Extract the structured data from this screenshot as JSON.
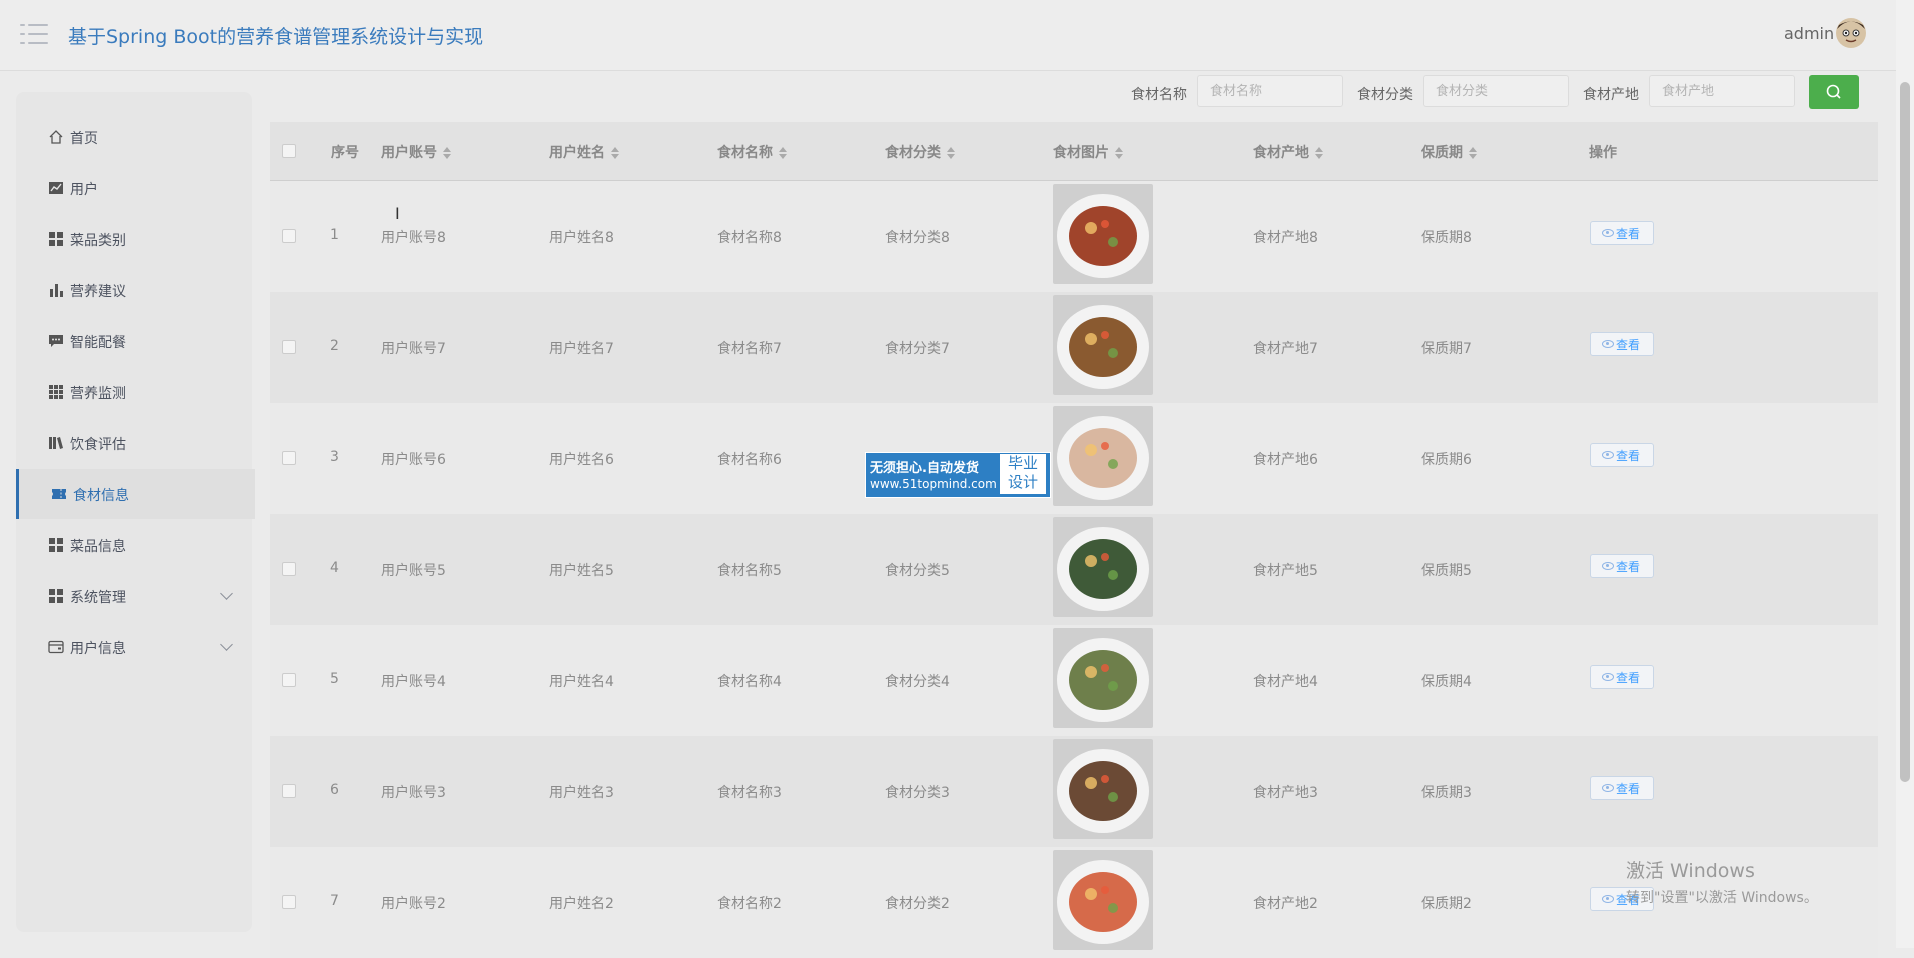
{
  "header": {
    "title": "基于Spring Boot的营养食谱管理系统设计与实现",
    "username": "admin"
  },
  "sidebar": {
    "items": [
      {
        "label": "首页",
        "icon": "home-icon",
        "active": false,
        "expandable": false
      },
      {
        "label": "用户",
        "icon": "chart-line-icon",
        "active": false,
        "expandable": false
      },
      {
        "label": "菜品类别",
        "icon": "grid-icon",
        "active": false,
        "expandable": false
      },
      {
        "label": "营养建议",
        "icon": "bar-chart-icon",
        "active": false,
        "expandable": false
      },
      {
        "label": "智能配餐",
        "icon": "chat-icon",
        "active": false,
        "expandable": false
      },
      {
        "label": "营养监测",
        "icon": "grid-3x3-icon",
        "active": false,
        "expandable": false
      },
      {
        "label": "饮食评估",
        "icon": "book-icon",
        "active": false,
        "expandable": false
      },
      {
        "label": "食材信息",
        "icon": "ticket-icon",
        "active": true,
        "expandable": false
      },
      {
        "label": "菜品信息",
        "icon": "grid-icon",
        "active": false,
        "expandable": false
      },
      {
        "label": "系统管理",
        "icon": "grid-icon",
        "active": false,
        "expandable": true
      },
      {
        "label": "用户信息",
        "icon": "card-icon",
        "active": false,
        "expandable": true
      }
    ]
  },
  "search": {
    "name_label": "食材名称",
    "name_placeholder": "食材名称",
    "category_label": "食材分类",
    "category_placeholder": "食材分类",
    "origin_label": "食材产地",
    "origin_placeholder": "食材产地",
    "button_icon": "search-icon"
  },
  "table": {
    "columns": [
      "序号",
      "用户账号",
      "用户姓名",
      "食材名称",
      "食材分类",
      "食材图片",
      "食材产地",
      "保质期",
      "操作"
    ],
    "rows": [
      {
        "index": "1",
        "account": "用户账号8",
        "name": "用户姓名8",
        "food_name": "食材名称8",
        "category": "食材分类8",
        "origin": "食材产地8",
        "shelf_life": "保质期8",
        "action": "查看",
        "image_color": "#a0442b"
      },
      {
        "index": "2",
        "account": "用户账号7",
        "name": "用户姓名7",
        "food_name": "食材名称7",
        "category": "食材分类7",
        "origin": "食材产地7",
        "shelf_life": "保质期7",
        "action": "查看",
        "image_color": "#8a5a30"
      },
      {
        "index": "3",
        "account": "用户账号6",
        "name": "用户姓名6",
        "food_name": "食材名称6",
        "category": "",
        "origin": "食材产地6",
        "shelf_life": "保质期6",
        "action": "查看",
        "image_color": "#d9b7a0"
      },
      {
        "index": "4",
        "account": "用户账号5",
        "name": "用户姓名5",
        "food_name": "食材名称5",
        "category": "食材分类5",
        "origin": "食材产地5",
        "shelf_life": "保质期5",
        "action": "查看",
        "image_color": "#3f5a38"
      },
      {
        "index": "5",
        "account": "用户账号4",
        "name": "用户姓名4",
        "food_name": "食材名称4",
        "category": "食材分类4",
        "origin": "食材产地4",
        "shelf_life": "保质期4",
        "action": "查看",
        "image_color": "#6e7f4b"
      },
      {
        "index": "6",
        "account": "用户账号3",
        "name": "用户姓名3",
        "food_name": "食材名称3",
        "category": "食材分类3",
        "origin": "食材产地3",
        "shelf_life": "保质期3",
        "action": "查看",
        "image_color": "#6b4a35"
      },
      {
        "index": "7",
        "account": "用户账号2",
        "name": "用户姓名2",
        "food_name": "食材名称2",
        "category": "食材分类2",
        "origin": "食材产地2",
        "shelf_life": "保质期2",
        "action": "查看",
        "image_color": "#d66a4a"
      }
    ]
  },
  "watermark": {
    "main": "无须担心.自动发货",
    "url": "www.51topmind.com",
    "side_line1": "毕业",
    "side_line2": "设计"
  },
  "os_overlay": {
    "line1": "激活 Windows",
    "line2": "转到\"设置\"以激活 Windows。"
  },
  "colors": {
    "brand": "#3a7bbd",
    "accent": "#2f6fb0",
    "search_button": "#4cae4c",
    "link": "#409eff"
  }
}
